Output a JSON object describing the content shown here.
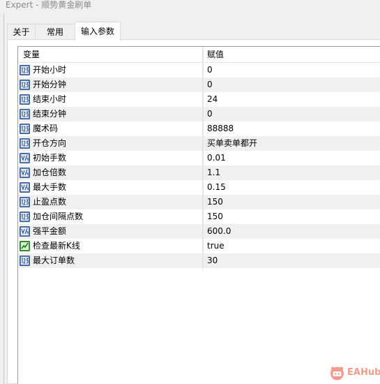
{
  "window": {
    "title": "Expert - 顺势黄金刷单"
  },
  "tabs": [
    {
      "label": "关于",
      "active": false
    },
    {
      "label": "常用",
      "active": false
    },
    {
      "label": "输入参数",
      "active": true
    }
  ],
  "table": {
    "columns": {
      "variable": "变量",
      "value": "赋值"
    },
    "rows": [
      {
        "name": "开始小时",
        "value": "0",
        "type": "int"
      },
      {
        "name": "开始分钟",
        "value": "0",
        "type": "int"
      },
      {
        "name": "结束小时",
        "value": "24",
        "type": "int"
      },
      {
        "name": "结束分钟",
        "value": "0",
        "type": "int"
      },
      {
        "name": "魔术码",
        "value": "88888",
        "type": "int"
      },
      {
        "name": "开仓方向",
        "value": "买单卖单都开",
        "type": "int"
      },
      {
        "name": "初始手数",
        "value": "0.01",
        "type": "double"
      },
      {
        "name": "加仓倍数",
        "value": "1.1",
        "type": "double"
      },
      {
        "name": "最大手数",
        "value": "0.15",
        "type": "double"
      },
      {
        "name": "止盈点数",
        "value": "150",
        "type": "int"
      },
      {
        "name": "加仓间隔点数",
        "value": "150",
        "type": "int"
      },
      {
        "name": "强平金额",
        "value": "600.0",
        "type": "double"
      },
      {
        "name": "检查最新K线",
        "value": "true",
        "type": "bool"
      },
      {
        "name": "最大订单数",
        "value": "30",
        "type": "int"
      }
    ]
  },
  "icons": {
    "int": "integer-type-icon",
    "double": "double-type-icon",
    "bool": "boolean-type-icon"
  },
  "watermark": {
    "text": "EAHub",
    "color": "#f39b8a"
  }
}
